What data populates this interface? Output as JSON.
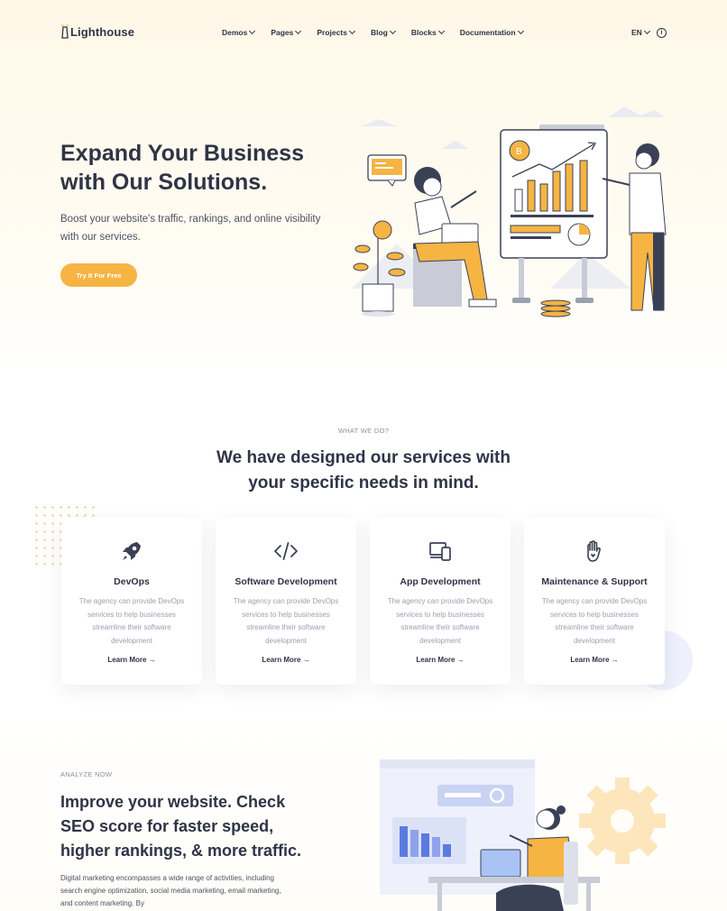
{
  "brand": {
    "name": "Lighthouse"
  },
  "nav": {
    "items": [
      {
        "label": "Demos"
      },
      {
        "label": "Pages"
      },
      {
        "label": "Projects"
      },
      {
        "label": "Blog"
      },
      {
        "label": "Blocks"
      },
      {
        "label": "Documentation"
      }
    ],
    "lang": "EN"
  },
  "hero": {
    "title_line1": "Expand Your Business",
    "title_line2": "with Our Solutions.",
    "subtitle": "Boost your website's traffic, rankings, and online visibility with our services.",
    "cta": "Try It For Free"
  },
  "services": {
    "eyebrow": "WHAT WE DO?",
    "title_line1": "We have designed our services with",
    "title_line2": "your specific needs in mind.",
    "cards": [
      {
        "icon": "rocket-icon",
        "title": "DevOps",
        "desc": "The agency can provide DevOps services to help businesses streamline their software development",
        "link": "Learn More"
      },
      {
        "icon": "code-icon",
        "title": "Software Development",
        "desc": "The agency can provide DevOps services to help businesses streamline their software development",
        "link": "Learn More"
      },
      {
        "icon": "devices-icon",
        "title": "App Development",
        "desc": "The agency can provide DevOps services to help businesses streamline their software development",
        "link": "Learn More"
      },
      {
        "icon": "hand-heart-icon",
        "title": "Maintenance & Support",
        "desc": "The agency can provide DevOps services to help businesses streamline their software development",
        "link": "Learn More"
      }
    ]
  },
  "analyze": {
    "eyebrow": "ANALYZE NOW",
    "title_line1": "Improve your website. Check",
    "title_line2": "SEO score for faster speed,",
    "title_line3": "higher rankings, & more traffic.",
    "text": "Digital marketing encompasses a wide range of activities, including search engine optimization, social media marketing, email marketing, and content marketing. By"
  },
  "colors": {
    "accent": "#f6b443",
    "text": "#2f3446",
    "muted": "#9aa0ae",
    "blue": "#5b7be0"
  }
}
